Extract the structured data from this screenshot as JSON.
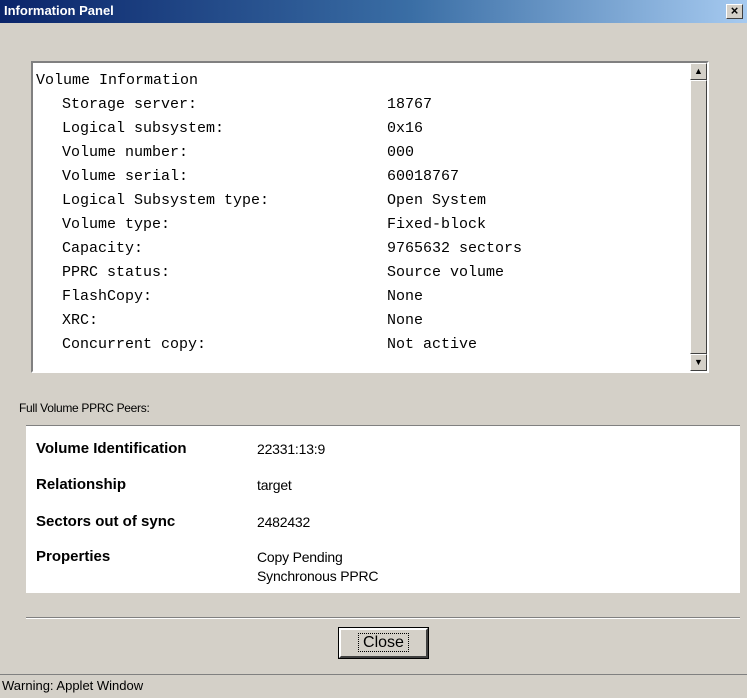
{
  "window": {
    "title": "Information Panel",
    "close_glyph": "×"
  },
  "volume_info": {
    "heading": "Volume Information",
    "rows": [
      {
        "label": "Storage server:",
        "value": "18767"
      },
      {
        "label": "Logical subsystem:",
        "value": "0x16"
      },
      {
        "label": "Volume number:",
        "value": "000"
      },
      {
        "label": "Volume serial:",
        "value": "60018767"
      },
      {
        "label": "Logical Subsystem type:",
        "value": "Open System"
      },
      {
        "label": "Volume type:",
        "value": "Fixed-block"
      },
      {
        "label": "Capacity:",
        "value": "9765632 sectors"
      },
      {
        "label": "PPRC status:",
        "value": "Source volume"
      },
      {
        "label": "FlashCopy:",
        "value": "None"
      },
      {
        "label": "XRC:",
        "value": "None"
      },
      {
        "label": "Concurrent copy:",
        "value": "Not active"
      }
    ],
    "scroll_up_icon": "▲",
    "scroll_down_icon": "▼"
  },
  "peers": {
    "title": "Full Volume PPRC Peers:",
    "rows": [
      {
        "label": "Volume Identification",
        "value": "22331:13:9"
      },
      {
        "label": "Relationship",
        "value": "target"
      },
      {
        "label": "Sectors out of sync",
        "value": "2482432"
      },
      {
        "label": "Properties",
        "value": "Copy Pending",
        "value2": "Synchronous PPRC"
      }
    ]
  },
  "buttons": {
    "close_label": "Close"
  },
  "status_bar": {
    "text": "Warning: Applet Window"
  },
  "colors": {
    "title_gradient_start": "#0a246a",
    "title_gradient_end": "#a6caf0",
    "window_background": "#d4d0c8"
  }
}
